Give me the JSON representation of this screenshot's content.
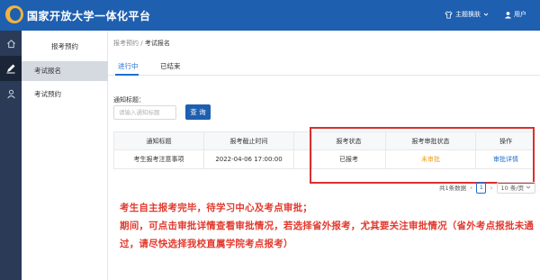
{
  "header": {
    "app_title": "国家开放大学一体化平台",
    "theme_switch_label": "主题换肤",
    "user_label": "用户"
  },
  "colors": {
    "header_bg": "#1e5fb0",
    "primary": "#1e5fb0",
    "link": "#1e6fd0",
    "pending": "#f0a020",
    "annotation_red": "#e23a2e"
  },
  "iconbar": {
    "items": [
      {
        "icon": "home-icon"
      },
      {
        "icon": "edit-icon"
      },
      {
        "icon": "person-icon"
      }
    ]
  },
  "sidenav": {
    "group_title": "报考预约",
    "items": [
      {
        "label": "考试报名",
        "active": true
      },
      {
        "label": "考试预约",
        "active": false
      }
    ]
  },
  "breadcrumb": {
    "parent": "报考预约",
    "separator": "/",
    "current": "考试报名"
  },
  "tabs": [
    {
      "label": "进行中",
      "active": true
    },
    {
      "label": "已结束",
      "active": false
    }
  ],
  "filter": {
    "label": "通知标题：",
    "input_value": "",
    "placeholder": "请输入通知标题",
    "query_button": "查 询"
  },
  "table": {
    "columns": [
      "通知标题",
      "报考截止时间",
      "",
      "报考状态",
      "报考审批状态",
      "操作"
    ],
    "rows": [
      {
        "title": "考生报考注意事项",
        "deadline": "2022-04-06 17:00:00",
        "extra": "",
        "status": "已报考",
        "approval_status": "未审批",
        "action": "审批详情"
      }
    ]
  },
  "pagination": {
    "total_text": "共1条数据",
    "prev": "‹",
    "current_page": "1",
    "next": "›",
    "page_size": "10 条/页"
  },
  "annotation": {
    "lines": [
      "考生自主报考完毕，待学习中心及考点审批；",
      "期间，可点击审批详情查看审批情况，若选择省外报考，尤其要关注审批情况（省外考点报批未通",
      "过，请尽快选择我校直属学院考点报考）"
    ]
  }
}
